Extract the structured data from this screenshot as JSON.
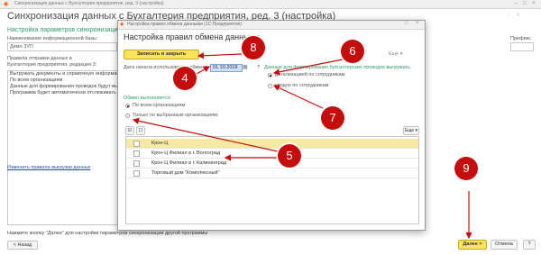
{
  "window": {
    "titlebar_text": "Синхронизация данных с Бухгалтерия предприятия, ред. 3 (настройка)",
    "title": "Синхронизация данных с Бухгалтерия предприятия, ред. 3 (настройка)",
    "section_heading": "Настройка параметров синхронизации д",
    "db_name_label": "Наименование информационной базы:",
    "db_name_value": "Демо ЗУП",
    "prefix_label": "Префикс",
    "send_rules_label_1": "Правила отправки данных в",
    "send_rules_label_2": "Бухгалтерия предприятия, редакция 3:",
    "desc_lines": [
      "Выгружать документы и справочную информацию",
      "По всем организациям",
      "Данные для формирования проводок будут вы",
      "Программа будет автоматически отслеживать"
    ],
    "change_rules_link": "Изменить правила выгрузки данных",
    "footer_note": "Нажмите кнопку \"Далее\" для настройки параметров синхронизации другой программы",
    "back_button": "< Назад",
    "next_button": "Далее >",
    "cancel_button": "Отмена",
    "help_button": "?"
  },
  "dialog": {
    "titlebar_text": "Настройка правил обмена данными (1С:Предприятие)",
    "heading": "Настройка правил обмена данными",
    "save_close_button": "Записать и закрыть",
    "more_menu": "Еще ▾",
    "date_label": "Дата начала использования обмена:",
    "date_value": "01.10.2018",
    "date_help": "?",
    "postings_label": "Данные для формирования бухгалтерских проводок выгружать",
    "postings_options": [
      "детализацией по сотрудникам",
      "сводно по сотрудникам"
    ],
    "postings_selected": 0,
    "exchange_label": "Обмен выполняется",
    "exchange_options": [
      "По всем организациям",
      "Только по выбранным организациям:"
    ],
    "exchange_selected": 0,
    "table_more": "Еще ▾",
    "organizations": [
      "Крон-Ц",
      "Крон-Ц Филиал в г. Волгоград",
      "Крон-Ц Филиал в г. Калининград",
      "Торговый дом \"Комплексный\""
    ],
    "selected_row": 0
  },
  "annotations": [
    "4",
    "5",
    "6",
    "7",
    "8",
    "9"
  ],
  "colors": {
    "accent_yellow": "#fbe45b",
    "green_heading": "#2e9a67",
    "marker_red": "#c40e0e",
    "selected_row": "#f6eaa3",
    "date_highlight": "#cfe0fb"
  }
}
